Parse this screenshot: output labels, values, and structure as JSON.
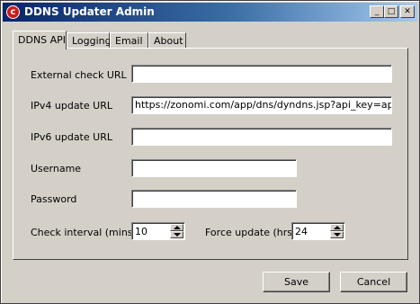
{
  "window": {
    "title": "DDNS Updater Admin",
    "icon": "app-icon",
    "controls": {
      "minimize": "_",
      "maximize": "□",
      "close": "✕"
    }
  },
  "tabs": [
    {
      "label": "DDNS API",
      "active": true
    },
    {
      "label": "Logging",
      "active": false
    },
    {
      "label": "Email",
      "active": false
    },
    {
      "label": "About",
      "active": false
    }
  ],
  "form": {
    "external_check_url": {
      "label": "External check URL",
      "value": ""
    },
    "ipv4_update_url": {
      "label": "IPv4 update URL",
      "value": "https://zonomi.com/app/dns/dyndns.jsp?api_key=apikeyva"
    },
    "ipv6_update_url": {
      "label": "IPv6 update URL",
      "value": ""
    },
    "username": {
      "label": "Username",
      "value": ""
    },
    "password": {
      "label": "Password",
      "value": ""
    },
    "check_interval": {
      "label": "Check interval (mins)",
      "value": "10"
    },
    "force_update": {
      "label": "Force update (hrs)",
      "value": "24"
    }
  },
  "buttons": {
    "save": "Save",
    "cancel": "Cancel"
  },
  "colors": {
    "face": "#d4d0c8",
    "title_start": "#0a246a",
    "title_end": "#a6caf0"
  }
}
